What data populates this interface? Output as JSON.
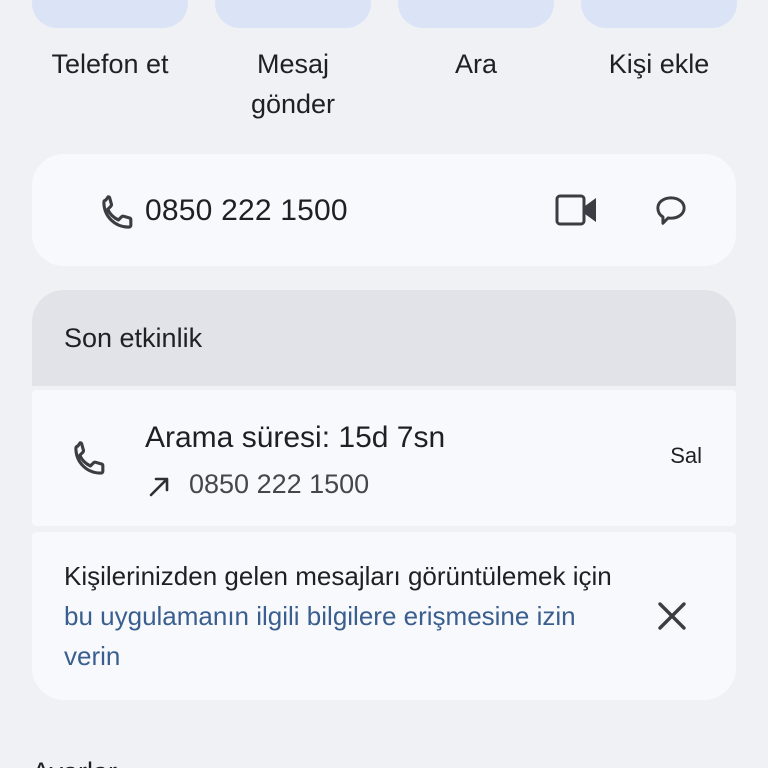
{
  "actions": [
    {
      "label": "Telefon et"
    },
    {
      "label": "Mesaj\ngönder"
    },
    {
      "label": "Ara"
    },
    {
      "label": "Kişi ekle"
    }
  ],
  "phone_card": {
    "number": "0850 222 1500",
    "icons": [
      "phone-icon",
      "video-call-icon",
      "message-icon"
    ]
  },
  "activity": {
    "title": "Son etkinlik",
    "call": {
      "title": "Arama süresi: 15d 7sn",
      "number": "0850 222 1500",
      "day": "Sal",
      "direction_icon": "outgoing-arrow-icon"
    }
  },
  "permission": {
    "prefix": "Kişilerinizden gelen mesajları görüntülemek için ",
    "link": "bu uygulamanın ilgili bilgilere erişmesine izin verin"
  },
  "settings": {
    "label": "Ayarlar"
  },
  "colors": {
    "background": "#eff1f5",
    "card": "#f8f9fd",
    "bubble": "#dbe4f6",
    "section_header": "#e1e3e8",
    "link": "#3a5f8e"
  }
}
